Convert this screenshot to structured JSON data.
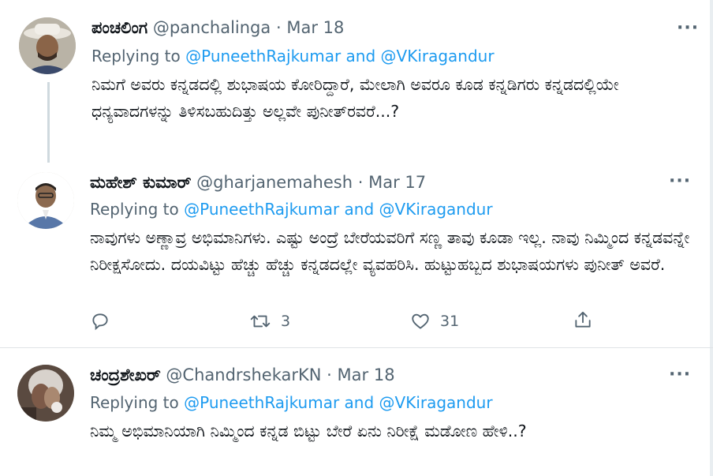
{
  "tweets": [
    {
      "name": "ಪಂಚಲಿಂಗ",
      "handle": "@panchalinga",
      "separator": "·",
      "date": "Mar 18",
      "replying_prefix": "Replying to",
      "replying_users": "@PuneethRajkumar and @VKiragandur",
      "text": "ನಿಮಗೆ ಅವರು ಕನ್ನಡದಲ್ಲಿ ಶುಭಾಷಯ ಕೋರಿದ್ದಾರೆ, ಮೇಲಾಗಿ ಅವರೂ ಕೂಡ ಕನ್ನಡಿಗರು ಕನ್ನಡದಲ್ಲಿಯೇ ಧನ್ಯವಾದಗಳನ್ನು ತಿಳಿಸಬಹುದಿತ್ತು ಅಲ್ಲವೇ ಪುನೀತ್‌ರವರೆ...?"
    },
    {
      "name": "ಮಹೇಶ್ ಕುಮಾರ್",
      "handle": "@gharjanemahesh",
      "separator": "·",
      "date": "Mar 17",
      "replying_prefix": "Replying to",
      "replying_users": "@PuneethRajkumar and @VKiragandur",
      "text": "ನಾವುಗಳು ಅಣ್ಣಾವ್ರ ಅಭಿಮಾನಿಗಳು. ಎಷ್ಟು ಅಂದ್ರೆ ಬೇರೆಯವರಿಗೆ ಸಣ್ಣ ತಾವು ಕೂಡಾ ಇಲ್ಲ. ನಾವು ನಿಮ್ಮಿಂದ ಕನ್ನಡವನ್ನೇ ನಿರೀಕ್ಷಸೋದು. ದಯವಿಟ್ಟು ಹೆಚ್ಚು ಹೆಚ್ಚು ಕನ್ನಡದಲ್ಲೇ ವ್ಯವಹರಿಸಿ. ಹುಟ್ಟುಹಬ್ಬದ ಶುಭಾಷಯಗಳು ಪುನೀತ್ ಅವರೆ.",
      "actions": {
        "reply_count": "",
        "retweet_count": "3",
        "like_count": "31"
      }
    },
    {
      "name": "ಚಂದ್ರಶೇಖರ್",
      "handle": "@ChandrshekarKN",
      "separator": "·",
      "date": "Mar 18",
      "replying_prefix": "Replying to",
      "replying_users": "@PuneethRajkumar and @VKiragandur",
      "text": "ನಿಮ್ಮ ಅಭಿಮಾನಿಯಾಗಿ ನಿಮ್ಮಿಂದ ಕನ್ನಡ ಬಿಟ್ಟು ಬೇರೆ ಏನು ನಿರೀಕ್ಷೆ ಮಡೋಣ ಹೇಳಿ..?"
    }
  ],
  "more_label": "···",
  "icons": {
    "more": "more-icon",
    "reply": "reply-icon",
    "retweet": "retweet-icon",
    "like": "like-icon",
    "share": "share-icon"
  },
  "colors": {
    "link": "#1d9bf0",
    "secondary_text": "#536471",
    "thread_line": "#cfd9de"
  }
}
